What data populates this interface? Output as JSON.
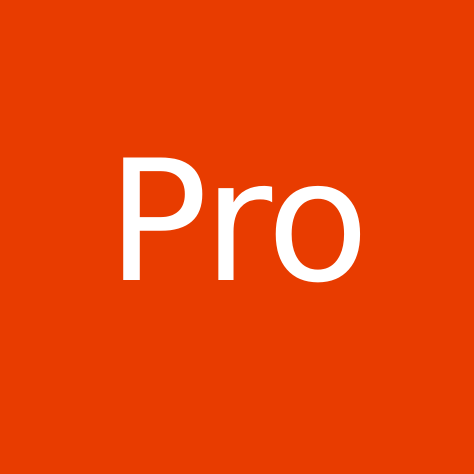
{
  "tile": {
    "text": "Pro",
    "background_color": "#e83c00",
    "text_color": "#ffffff"
  }
}
